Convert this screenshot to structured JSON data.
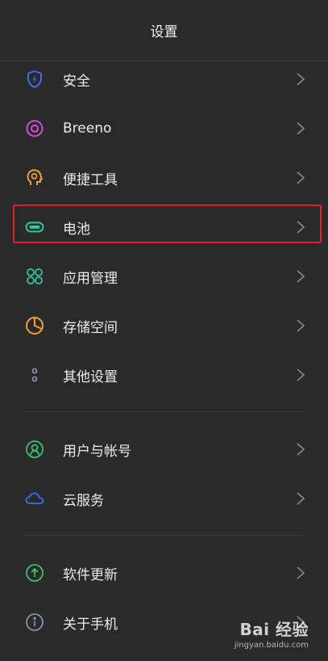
{
  "header": {
    "title": "设置"
  },
  "section1": [
    {
      "name": "security",
      "label": "安全",
      "icon": "shield-icon",
      "color": "#3b6cf0"
    },
    {
      "name": "breeno",
      "label": "Breeno",
      "icon": "breeno-circle-icon",
      "color": "#d44fd6"
    },
    {
      "name": "convenience-tools",
      "label": "便捷工具",
      "icon": "head-gear-icon",
      "color": "#f2a033"
    },
    {
      "name": "battery",
      "label": "电池",
      "icon": "battery-icon",
      "color": "#2ec5a0"
    },
    {
      "name": "app-management",
      "label": "应用管理",
      "icon": "app-grid-icon",
      "color": "#2ec5a0"
    },
    {
      "name": "storage",
      "label": "存储空间",
      "icon": "pie-chart-icon",
      "color": "#f2a033"
    },
    {
      "name": "other-settings",
      "label": "其他设置",
      "icon": "dots-icon",
      "color": "#8a9cc8"
    }
  ],
  "section2": [
    {
      "name": "user-account",
      "label": "用户与帐号",
      "icon": "user-icon",
      "color": "#3fbf6a"
    },
    {
      "name": "cloud-service",
      "label": "云服务",
      "icon": "cloud-icon",
      "color": "#3b6cf0"
    }
  ],
  "section3": [
    {
      "name": "software-update",
      "label": "软件更新",
      "icon": "upload-arrow-icon",
      "color": "#3fbf6a"
    },
    {
      "name": "about-phone",
      "label": "关于手机",
      "icon": "info-icon",
      "color": "#8a9cc8"
    }
  ],
  "watermark": {
    "brand": "Bai 经验",
    "url": "jingyan.baidu.com"
  }
}
